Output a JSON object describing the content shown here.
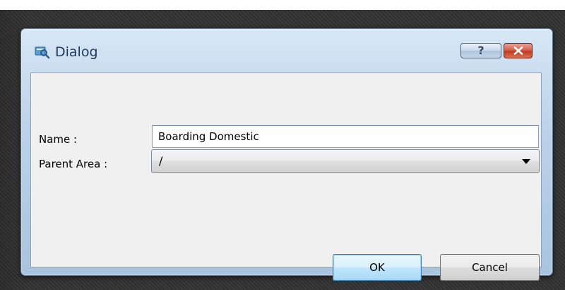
{
  "window": {
    "title": "Dialog",
    "icon": "dialog-app-icon",
    "help_button_icon": "help-icon",
    "close_button_icon": "close-icon"
  },
  "form": {
    "name_label": "Name :",
    "name_value": "Boarding Domestic",
    "parent_area_label": "Parent Area :",
    "parent_area_value": "/"
  },
  "buttons": {
    "ok_label": "OK",
    "cancel_label": "Cancel"
  },
  "colors": {
    "frame_accent": "#bcd3ea",
    "close_button": "#c23a22",
    "default_button_highlight": "#bee6fd"
  }
}
